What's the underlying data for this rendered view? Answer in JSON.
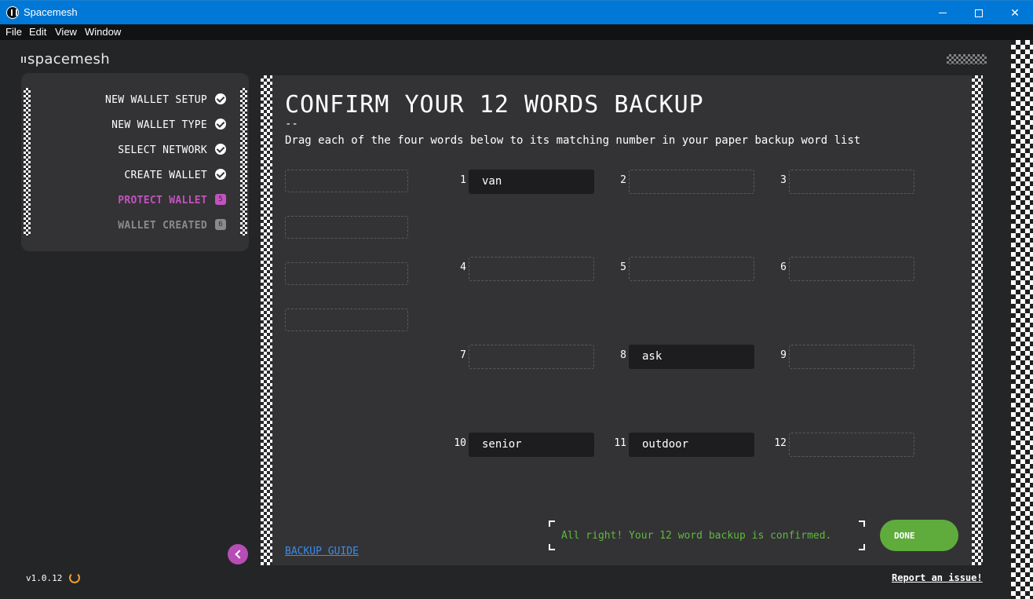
{
  "window": {
    "title": "Spacemesh",
    "minimize_glyph": "",
    "close_glyph": "✕"
  },
  "menu": [
    "File",
    "Edit",
    "View",
    "Window"
  ],
  "app": {
    "logo_text": "spacemesh",
    "version": "v1.0.12",
    "report_link": "Report an issue!"
  },
  "steps": [
    {
      "label": "NEW WALLET SETUP",
      "state": "done"
    },
    {
      "label": "NEW WALLET TYPE",
      "state": "done"
    },
    {
      "label": "SELECT NETWORK",
      "state": "done"
    },
    {
      "label": "CREATE WALLET",
      "state": "done"
    },
    {
      "label": "PROTECT WALLET",
      "state": "active",
      "number": "5"
    },
    {
      "label": "WALLET CREATED",
      "state": "inactive",
      "number": "6"
    }
  ],
  "main": {
    "title": "CONFIRM YOUR 12 WORDS BACKUP",
    "separator": "--",
    "subtitle": "Drag each of the four words below to its matching number in your paper backup word list",
    "slots": [
      {
        "number": "1",
        "word": "van"
      },
      {
        "number": "2",
        "word": ""
      },
      {
        "number": "3",
        "word": ""
      },
      {
        "number": "4",
        "word": ""
      },
      {
        "number": "5",
        "word": ""
      },
      {
        "number": "6",
        "word": ""
      },
      {
        "number": "7",
        "word": ""
      },
      {
        "number": "8",
        "word": "ask"
      },
      {
        "number": "9",
        "word": ""
      },
      {
        "number": "10",
        "word": "senior"
      },
      {
        "number": "11",
        "word": "outdoor"
      },
      {
        "number": "12",
        "word": ""
      }
    ],
    "backup_guide": "BACKUP GUIDE",
    "confirm_message": "All right! Your 12 word backup is confirmed.",
    "done_label": "DONE"
  },
  "colors": {
    "titlebar": "#0078d7",
    "accent_purple": "#c252c1",
    "success_green": "#5fba3a",
    "done_button": "#5fac3d",
    "link_blue": "#3c8ce7"
  },
  "icons": [
    "app-icon",
    "check-icon",
    "back-arrow-icon",
    "refresh-icon"
  ]
}
